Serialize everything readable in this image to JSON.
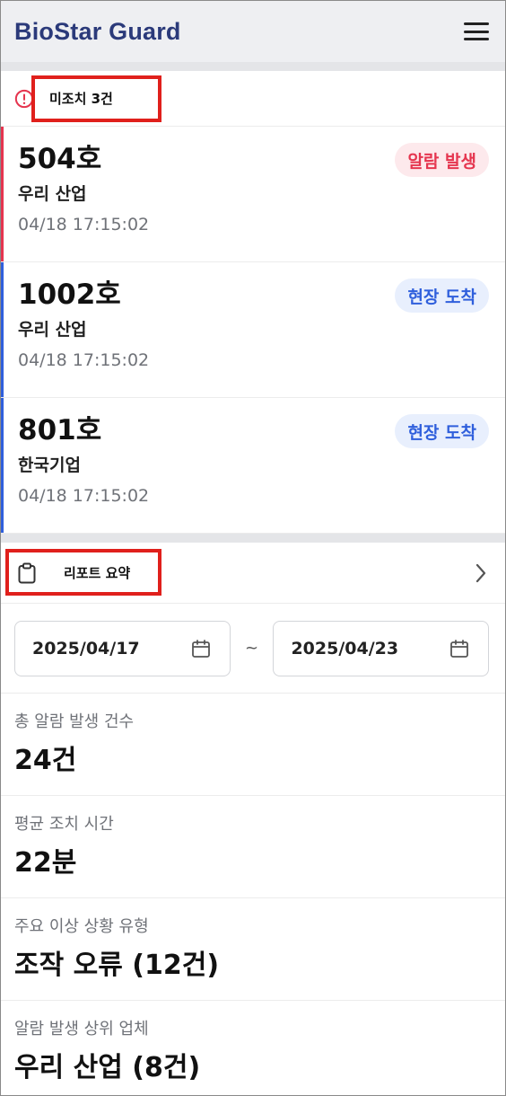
{
  "header": {
    "title": "BioStar Guard",
    "menu_icon": "hamburger-menu-icon"
  },
  "unhandled": {
    "icon": "alert-circle-icon",
    "label": "미조치 3건",
    "icon_color": "#e5354f"
  },
  "alarms": [
    {
      "room": "504호",
      "company": "우리 산업",
      "time": "04/18 17:15:02",
      "status": "알람 발생",
      "status_type": "alarm",
      "stripe_color": "#e5354f"
    },
    {
      "room": "1002호",
      "company": "우리 산업",
      "time": "04/18 17:15:02",
      "status": "현장 도착",
      "status_type": "arrived",
      "stripe_color": "#2f5fdc"
    },
    {
      "room": "801호",
      "company": "한국기업",
      "time": "04/18 17:15:02",
      "status": "현장 도착",
      "status_type": "arrived",
      "stripe_color": "#2f5fdc"
    }
  ],
  "report": {
    "icon": "clipboard-icon",
    "label": "리포트 요약",
    "chevron_icon": "chevron-right-icon",
    "date_from": "2025/04/17",
    "date_to": "2025/04/23",
    "date_separator": "~",
    "calendar_icon": "calendar-icon",
    "stats": [
      {
        "label": "총 알람 발생 건수",
        "value": "24건"
      },
      {
        "label": "평균 조치 시간",
        "value": "22분"
      },
      {
        "label": "주요 이상 상황 유형",
        "value": "조작 오류 (12건)"
      },
      {
        "label": "알람 발생 상위 업체",
        "value": "우리 산업 (8건)"
      }
    ]
  },
  "colors": {
    "brand": "#2b3a7a",
    "alarm": "#e5354f",
    "arrived": "#2f5fdc",
    "highlight_box": "#e0201c"
  }
}
